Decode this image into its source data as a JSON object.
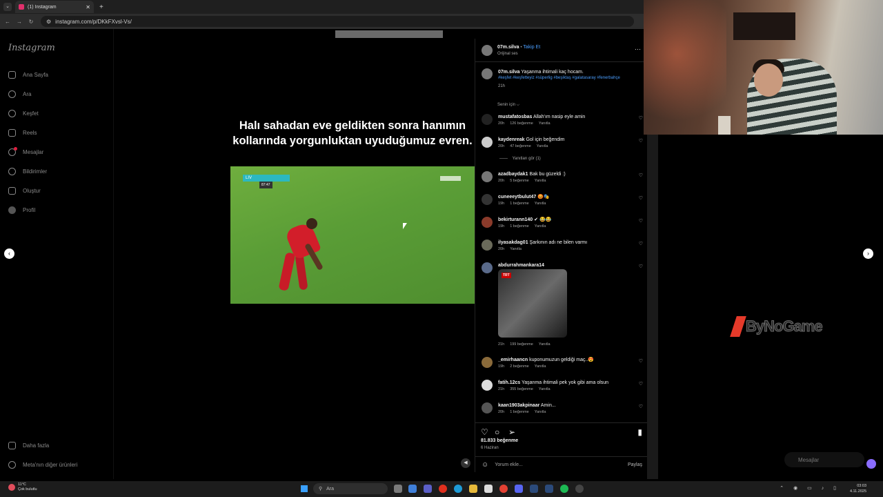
{
  "browser": {
    "tab_title": "(1) Instagram",
    "tab_close": "✕",
    "new_tab": "+",
    "url": "instagram.com/p/DKkFXvsl-Vs/"
  },
  "sidebar": {
    "logo": "Instagram",
    "items": [
      {
        "label": "Ana Sayfa",
        "icon": "home-icon"
      },
      {
        "label": "Ara",
        "icon": "search-icon"
      },
      {
        "label": "Keşfet",
        "icon": "compass-icon"
      },
      {
        "label": "Reels",
        "icon": "reels-icon"
      },
      {
        "label": "Mesajlar",
        "icon": "messenger-icon"
      },
      {
        "label": "Bildirimler",
        "icon": "heart-icon"
      },
      {
        "label": "Oluştur",
        "icon": "plus-icon"
      },
      {
        "label": "Profil",
        "icon": "avatar"
      }
    ],
    "more": "Daha fazla",
    "meta": "Meta'nın diğer ürünleri"
  },
  "video": {
    "caption": "Halı sahadan eve geldikten sonra hanımın kollarında yorgunluktan uyuduğumuz evren.",
    "score_team": "LIV",
    "score_time": "87:47"
  },
  "post": {
    "username": "07m.silva",
    "follow": "Takip Et",
    "audio": "Orijinal ses",
    "caption_user": "07m.silva",
    "caption_text": "Yaşanma ihtimali kaç hocam.",
    "hashtags": "#keşfet #keşfetteyiz #süperlig #beşiktaş #galatasaray #fenerbahçe",
    "caption_time": "21h",
    "sort": "Senin için ⌵",
    "likes": "81.833 beğenme",
    "date": "6 Haziran",
    "comment_placeholder": "Yorum ekle...",
    "share": "Paylaş"
  },
  "comments": [
    {
      "user": "mustafatosbas",
      "text": "Allah'ım nasip eyle amin",
      "time": "20h",
      "likes": "126 beğenme",
      "reply": "Yanıtla"
    },
    {
      "user": "kaydenreak",
      "text": "Gol için beğendim",
      "time": "20h",
      "likes": "47 beğenme",
      "reply": "Yanıtla",
      "view_replies": "Yanıtları gör (1)"
    },
    {
      "user": "azadbaydak1",
      "text": "Bak bu güzeldi :)",
      "time": "20h",
      "likes": "5 beğenme",
      "reply": "Yanıtla"
    },
    {
      "user": "cuneeeytbulut47",
      "text": "😡🎭",
      "time": "19h",
      "likes": "1 beğenme",
      "reply": "Yanıtla"
    },
    {
      "user": "bekirturann140",
      "text": "✔ 😂😂",
      "time": "19h",
      "likes": "1 beğenme",
      "reply": "Yanıtla"
    },
    {
      "user": "ilyasakdag01",
      "text": "Şarkının adı ne bilen varmı",
      "time": "20h",
      "likes": "",
      "reply": "Yanıtla"
    },
    {
      "user": "abdurrahmankara14",
      "text": "",
      "time": "21h",
      "likes": "199 beğenme",
      "reply": "Yanıtla",
      "sticker": "TRT"
    },
    {
      "user": "_emirhaancn",
      "text": "kuponumuzun geldiği maç..😍",
      "time": "19h",
      "likes": "2 beğenme",
      "reply": "Yanıtla"
    },
    {
      "user": "fatih.12cs",
      "text": "Yaşanma ihtimali pek yok gibi ama olsun",
      "time": "21h",
      "likes": "355 beğenme",
      "reply": "Yanıtla"
    },
    {
      "user": "kaan1903akpinaar",
      "text": "Amin...",
      "time": "20h",
      "likes": "1 beğenme",
      "reply": "Yanıtla"
    }
  ],
  "overlay": {
    "logo_text": "ByNoGame",
    "messages": "Mesajlar"
  },
  "taskbar": {
    "temp": "11°C",
    "weather": "Çok bulutlu",
    "search": "Ara",
    "time": "03:03",
    "date": "4.11.2025"
  },
  "colors": {
    "accent_blue": "#4a9eff",
    "instagram_pink": "#e1306c",
    "pitch_green": "#5a9d36",
    "jersey_red": "#d21e2a"
  }
}
